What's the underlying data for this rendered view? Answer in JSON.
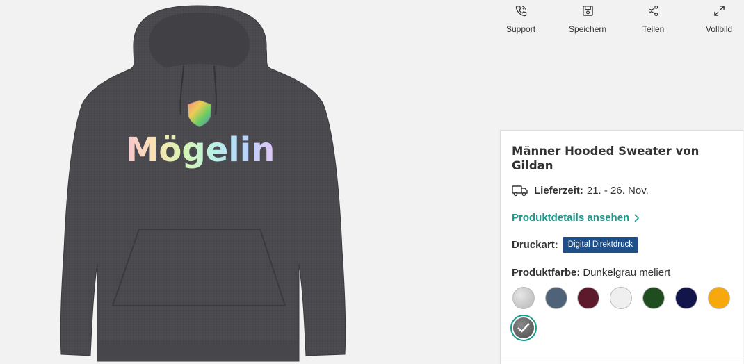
{
  "toolbar": {
    "support_label": "Support",
    "save_label": "Speichern",
    "share_label": "Teilen",
    "fullscreen_label": "Vollbild"
  },
  "product_image": {
    "print_text": "Mögelin",
    "garment_color": "#4a4a4e"
  },
  "card": {
    "title": "Männer Hooded Sweater von Gildan",
    "delivery_label": "Lieferzeit:",
    "delivery_value": "21. - 26. Nov.",
    "details_link": "Produktdetails ansehen",
    "print_label": "Druckart:",
    "print_badge": "Digital Direktdruck",
    "color_label": "Produktfarbe:",
    "color_value": "Dunkelgrau meliert",
    "swatches": [
      {
        "name": "heather-grey",
        "color": "#c8c8c8"
      },
      {
        "name": "slate-blue",
        "color": "#4f6378"
      },
      {
        "name": "maroon",
        "color": "#5c1a2c"
      },
      {
        "name": "white",
        "color": "#efefef"
      },
      {
        "name": "forest-green",
        "color": "#1f4d1f"
      },
      {
        "name": "navy",
        "color": "#12154a"
      },
      {
        "name": "gold",
        "color": "#f7a80d"
      },
      {
        "name": "dark-heather",
        "color": "#5a5a5a",
        "selected": true
      }
    ]
  },
  "accent_color": "#1a9a8c",
  "badge_color": "#1e4f89"
}
